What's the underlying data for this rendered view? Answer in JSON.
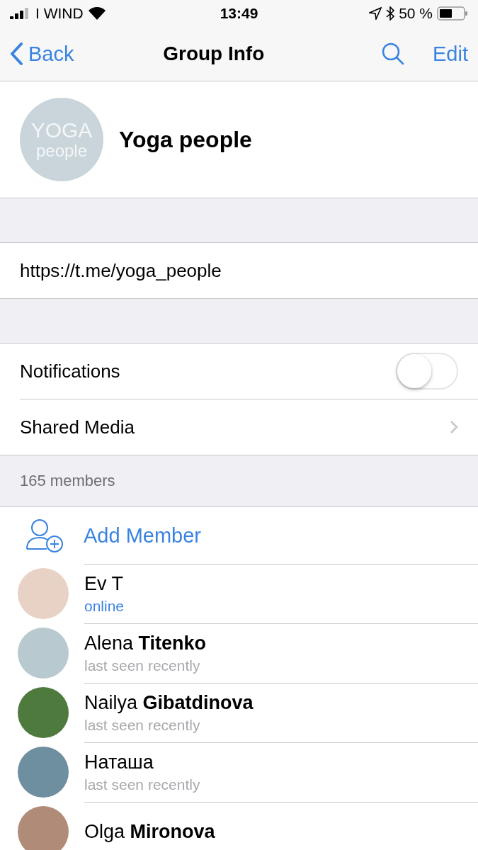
{
  "status_bar": {
    "carrier": "I WIND",
    "time": "13:49",
    "battery": "50 %"
  },
  "nav": {
    "back": "Back",
    "title": "Group Info",
    "edit": "Edit"
  },
  "group": {
    "avatar_text": [
      "YOGA",
      "people"
    ],
    "name": "Yoga people"
  },
  "link": "https://t.me/yoga_people",
  "settings": [
    {
      "kind": "toggle",
      "label": "Notifications",
      "on": false
    },
    {
      "kind": "link",
      "label": "Shared Media"
    }
  ],
  "members_header": "165 members",
  "add_member": "Add Member",
  "members": [
    {
      "name": "Ev T",
      "status": "online",
      "online": true
    },
    {
      "name": "Alena **Titenko**",
      "status": "last seen recently",
      "online": false
    },
    {
      "name": "Nailya **Gibatdinova**",
      "status": "last seen recently",
      "online": false
    },
    {
      "name": "Наташа",
      "status": "last seen recently",
      "online": false
    },
    {
      "name": "Olga **Mironova**"
    }
  ]
}
